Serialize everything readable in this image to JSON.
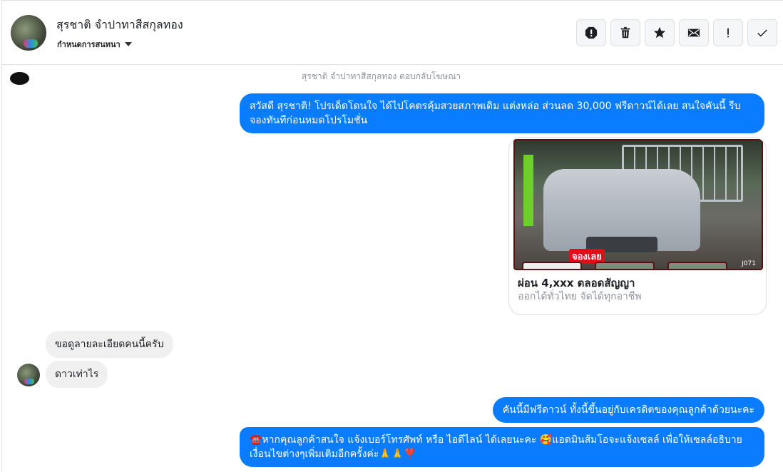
{
  "header": {
    "contact_name": "สุรชาติ จำปาทาสีสกุลทอง",
    "conversation_menu": "กำหนดการสนทนา",
    "actions": [
      {
        "name": "alert-icon",
        "label": "Mark as spam"
      },
      {
        "name": "trash-icon",
        "label": "Delete"
      },
      {
        "name": "star-icon",
        "label": "Star"
      },
      {
        "name": "mail-icon",
        "label": "Mark as unread"
      },
      {
        "name": "exclamation-icon",
        "label": "Follow up"
      },
      {
        "name": "check-icon",
        "label": "Done"
      }
    ]
  },
  "thread": {
    "ad_reply_note": "สุรชาติ จำปาทาสีสกุลทอง ตอบกลับโฆษณา",
    "messages": [
      {
        "direction": "out",
        "text": "สวัสดี สุรชาติ! โปรเด็ดโดนใจ ได้ไปโคตรคุ้มสวยสภาพเดิม แต่งหล่อ  ส่วนลด 30,000 ฟรีดาวน์ได้เลย  สนใจคันนี้ รีบจองทันทีก่อนหมดโปรโมชั่น"
      },
      {
        "direction": "out",
        "type": "card",
        "image_tag": "จองเลย",
        "image_code": "J071",
        "title": "ผ่อน 4,xxx ตลอดสัญญา",
        "subtitle": "ออกได้ทั่วไทย จัดได้ทุกอาชีพ"
      },
      {
        "direction": "in",
        "text": "ขอดูลายละเอียดคนนี้ครับ"
      },
      {
        "direction": "in",
        "text": "ดาวเท่าไร"
      },
      {
        "direction": "out",
        "text": "คันนี้มีฟรีดาวน์ ทั้งนี้ขึ้นอยู่กับเครดิตของคุณลูกค้าด้วยนะคะ"
      },
      {
        "direction": "out",
        "text": "☎️หากคุณลูกค้าสนใจ แจ้งเบอร์โทรศัพท์ หรือ ไอดีไลน์  ได้เลยนะคะ 🥰แอดมินส้มโอจะแจ้งเซลล์     เพื่อให้เซลล์อธิบายเงื่อนไขต่างๆเพิ่มเติมอีกครั้งค่ะ🙏🙏❣️"
      }
    ]
  },
  "colors": {
    "outgoing_bubble": "#0a7cff",
    "incoming_bubble": "#f0f0f0",
    "promo_tag": "#e30d17"
  }
}
